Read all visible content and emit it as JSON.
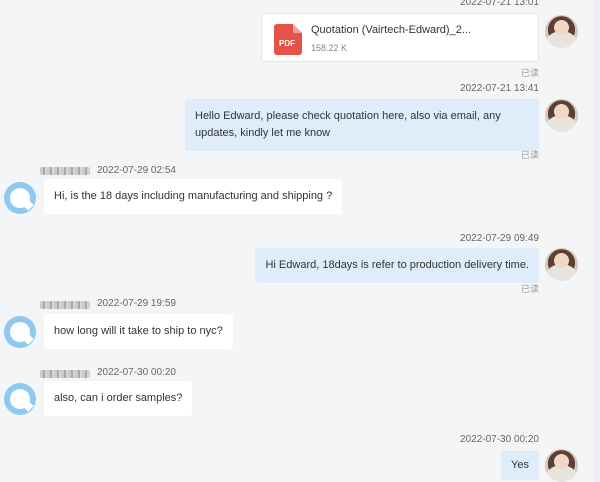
{
  "messages": [
    {
      "timestamp": "2022-07-21 13:01",
      "file_name": "Quotation (Vairtech-Edward)_2...",
      "file_size": "158.22 K",
      "file_badge": "PDF",
      "read": "已读"
    },
    {
      "timestamp": "2022-07-21 13:41",
      "text": "Hello Edward, please check quotation here, also via email, any updates, kindly let me know",
      "read": "已读"
    },
    {
      "timestamp": "2022-07-29 02:54",
      "text": "Hi, is the 18 days including manufacturing and shipping ?"
    },
    {
      "timestamp": "2022-07-29 09:49",
      "text": "Hi Edward, 18days is refer to production delivery time.",
      "read": "已读"
    },
    {
      "timestamp": "2022-07-29 19:59",
      "text": "how long will it take to ship to nyc?"
    },
    {
      "timestamp": "2022-07-30 00:20",
      "text": "also, can i order samples?"
    },
    {
      "timestamp": "2022-07-30 00:20",
      "text": "Yes"
    }
  ],
  "colors": {
    "outgoing_bubble": "#dfedfb",
    "incoming_bubble": "#ffffff",
    "background": "#f4f5f7",
    "pdf_red": "#e5524a",
    "bot_avatar": "#8ec9f2"
  },
  "icons": {
    "file": "pdf-file-icon",
    "bot_avatar": "chat-bubble-avatar-icon",
    "user_avatar": "user-photo-avatar"
  }
}
